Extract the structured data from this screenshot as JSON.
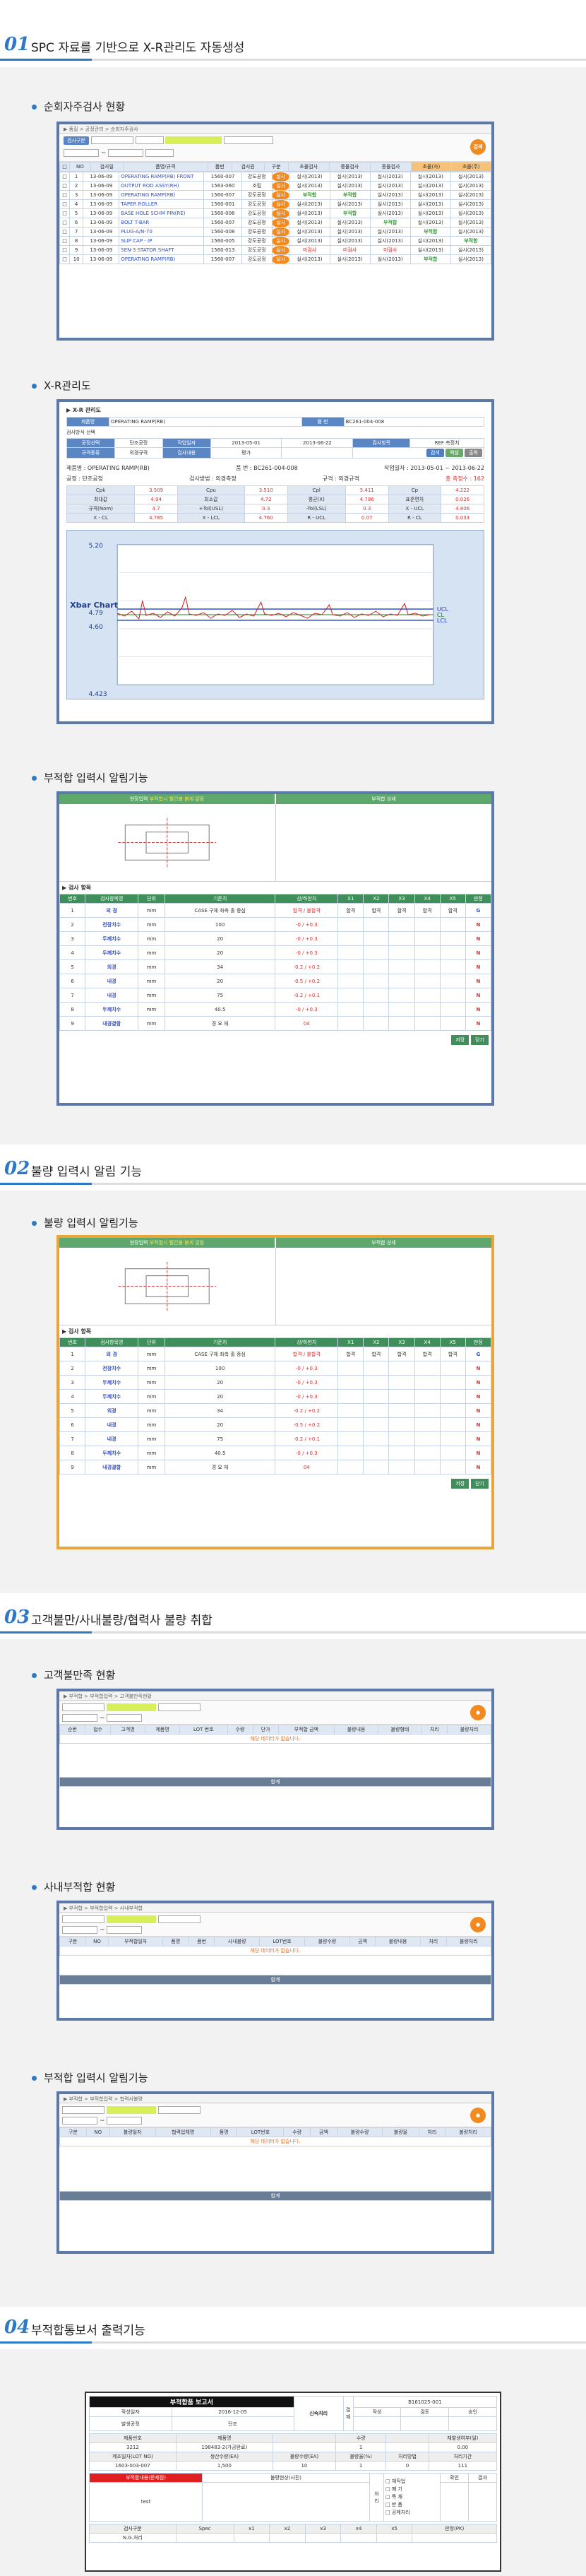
{
  "sections": [
    {
      "num": "01",
      "title": "SPC 자료를 기반으로 X-R관리도 자동생성"
    },
    {
      "num": "02",
      "title": "불량 입력시 알림 기능"
    },
    {
      "num": "03",
      "title": "고객불만/사내불량/협력사 불량 취합"
    },
    {
      "num": "04",
      "title": "부적합통보서 출력기능"
    }
  ],
  "subs": {
    "s1a": "순회자주검사 현황",
    "s1b": "X-R관리도",
    "s1c": "부적합 입력시 알림기능",
    "s2a": "불량 입력시 알림기능",
    "s3a": "고객불만족 현황",
    "s3b": "사내부적합 현황",
    "s3c": "부적합 입력시 알림기능",
    "s4": "부적합통보서 출력기능"
  },
  "inspection": {
    "breadcrumb": "▶ 품질 > 공정관리 > 순회자주검사",
    "search_btn": "검색",
    "filter_label": "검사구분",
    "headers": [
      "",
      "NO",
      "검사일",
      "품명/규격",
      "품번",
      "검사원",
      "구분",
      "초물검사",
      "중물검사",
      "종물검사",
      "초물(자)",
      "초물(주)",
      "비고"
    ],
    "rows": [
      [
        "1",
        "13-06-09",
        "OPERATING RAMP(RB) FRONT",
        "1560-007",
        "강도공정",
        "실시",
        "실시(2013)",
        "실시(2013)",
        "실시(2013)",
        "실시(2013)",
        "실시(2013)"
      ],
      [
        "2",
        "13-06-09",
        "OUTPUT ROD ASSY(RH)",
        "1563-060",
        "조립",
        "실시",
        "실시(2013)",
        "실시(2013)",
        "실시(2013)",
        "실시(2013)",
        "실시(2013)"
      ],
      [
        "3",
        "13-06-09",
        "OPERATING RAMP(RB)",
        "1560-007",
        "강도공정",
        "실시",
        "부적합",
        "부적합",
        "실시(2013)",
        "실시(2013)",
        "실시(2013)"
      ],
      [
        "4",
        "13-06-09",
        "TAPER ROLLER",
        "1560-001",
        "강도공정",
        "실시",
        "실시(2013)",
        "실시(2013)",
        "실시(2013)",
        "실시(2013)",
        "실시(2013)"
      ],
      [
        "5",
        "13-06-09",
        "BASE HOLE SCHM PIN(RE)",
        "1560-006",
        "강도공정",
        "실시",
        "실시(2013)",
        "부적합",
        "실시(2013)",
        "실시(2013)",
        "실시(2013)"
      ],
      [
        "6",
        "13-06-09",
        "BOLT T-BAR",
        "1560-007",
        "강도공정",
        "실시",
        "실시(2013)",
        "실시(2013)",
        "부적합",
        "실시(2013)",
        "실시(2013)"
      ],
      [
        "7",
        "13-06-09",
        "PLUG-A/N-70",
        "1560-008",
        "강도공정",
        "실시",
        "실시(2013)",
        "실시(2013)",
        "실시(2013)",
        "부적합",
        "실시(2013)"
      ],
      [
        "8",
        "13-06-09",
        "SLIP CAP - IP",
        "1560-005",
        "강도공정",
        "실시",
        "실시(2013)",
        "실시(2013)",
        "실시(2013)",
        "실시(2013)",
        "부적합"
      ],
      [
        "9",
        "13-06-09",
        "SEN-3 STATOR SHAFT",
        "1560-013",
        "강도공정",
        "실시",
        "미검사",
        "미검사",
        "미검사",
        "실시(2013)",
        "실시(2013)"
      ],
      [
        "10",
        "13-06-09",
        "OPERATING RAMP(RB)",
        "1560-007",
        "강도공정",
        "실시",
        "실시(2013)",
        "실시(2013)",
        "실시(2013)",
        "부적합",
        "실시(2013)"
      ]
    ]
  },
  "xr": {
    "title": "▶ X-R 관리도",
    "part_label": "제품명",
    "part_value": "OPERATING RAMP(RB)",
    "no_label": "품 번",
    "no_value": "BC261-004-008",
    "chk": "검사방식 선택",
    "r1": [
      "공정선택",
      "단조공정",
      "작업일자",
      "2013-05-01",
      "2013-06-22",
      "검사항목",
      "REF 측정치"
    ],
    "r2": [
      "규격종류",
      "외경규격",
      "검사내용",
      "평가"
    ],
    "btns": [
      "검색",
      "엑셀",
      "출력"
    ],
    "info": [
      "제품명 : OPERATING RAMP(RB)",
      "품 번 : BC261-004-008",
      "작업일자 : 2013-05-01 ~ 2013-06-22"
    ],
    "info2": [
      "공정 : 단조공정",
      "검사방법 : 외경측정",
      "규격 : 외경규격",
      "총 측정수 : 162"
    ],
    "stats": [
      [
        "Cpk",
        "3.509",
        "Cpu",
        "3.510",
        "Cpl",
        "5.411",
        "Cp",
        "4.222"
      ],
      [
        "최대값",
        "4.94",
        "최소값",
        "4.72",
        "평균(X)",
        "4.786",
        "표준편차",
        "0.026"
      ],
      [
        "규격(Nom)",
        "4.7",
        "+Tol(USL)",
        "0.3",
        "-Tol(LSL)",
        "0.3",
        "X - UCL",
        "4.806"
      ],
      [
        "X - CL",
        "4.785",
        "X - LCL",
        "4.760",
        "R - UCL",
        "0.07",
        "R - CL",
        "0.033"
      ]
    ],
    "chart_title": "Xbar Chart",
    "ymax": "5.20",
    "ymid": "4.79",
    "ymin": "4.60",
    "ybottom": "4.423",
    "legend": [
      "UCL",
      "CL",
      "LCL"
    ]
  },
  "ncr": {
    "tab_a": "현장입력",
    "tab_a_note": "부적합시 빨간불 붉게 알람",
    "tab_b": "부적합 상세",
    "sub_title": "▶ 검사 항목",
    "headers": [
      "번호",
      "검사항목명",
      "단위",
      "기준치",
      "상/하한치",
      "X1",
      "X2",
      "X3",
      "X4",
      "X5",
      "판정"
    ],
    "rows": [
      [
        "1",
        "외 경",
        "mm",
        "CASE 구체 좌측 홀 중심",
        "합격 / 불합격",
        "합격",
        "합격",
        "합격",
        "합격",
        "합격",
        "G"
      ],
      [
        "2",
        "전장치수",
        "mm",
        "100",
        "-0 / +0.3",
        "",
        "",
        "",
        "",
        "",
        "N"
      ],
      [
        "3",
        "두께치수",
        "mm",
        "20",
        "-0 / +0.3",
        "",
        "",
        "",
        "",
        "",
        "N"
      ],
      [
        "4",
        "두께치수",
        "mm",
        "20",
        "-0 / +0.3",
        "",
        "",
        "",
        "",
        "",
        "N"
      ],
      [
        "5",
        "외경",
        "mm",
        "34",
        "-0.2 / +0.2",
        "",
        "",
        "",
        "",
        "",
        "N"
      ],
      [
        "6",
        "내경",
        "mm",
        "20",
        "-0.5 / +0.2",
        "",
        "",
        "",
        "",
        "",
        "N"
      ],
      [
        "7",
        "내경",
        "mm",
        "75",
        "-0.2 / +0.1",
        "",
        "",
        "",
        "",
        "",
        "N"
      ],
      [
        "8",
        "두께치수",
        "mm",
        "40.5",
        "-0 / +0.3",
        "",
        "",
        "",
        "",
        "",
        "N"
      ],
      [
        "9",
        "내경결합",
        "mm",
        "경 요 체",
        "04",
        "",
        "",
        "",
        "",
        "",
        "N"
      ]
    ],
    "save": "저장",
    "close": "닫기"
  },
  "customer": {
    "breadcrumb": "▶ 부적합 > 부적합입력 > 고객불만족현황",
    "headers": [
      "순번",
      "접수",
      "고객명",
      "제품명",
      "LOT 번호",
      "수량",
      "단가",
      "부적합 금액",
      "불량내용",
      "불량형태",
      "처리",
      "불량처리"
    ],
    "empty": "해당 데이터가 없습니다.",
    "total": "합계"
  },
  "internal": {
    "breadcrumb": "▶ 부적합 > 부적합입력 > 사내부적합",
    "headers": [
      "구분",
      "NO",
      "부적합일자",
      "품명",
      "품번",
      "사내불량",
      "LOT번호",
      "불량수량",
      "금액",
      "불량내용",
      "처리",
      "불량처리"
    ],
    "empty": "해당 데이터가 없습니다.",
    "total": "합계"
  },
  "supplier": {
    "breadcrumb": "▶ 부적합 > 부적합입력 > 협력사불량",
    "headers": [
      "구분",
      "NO",
      "불량일자",
      "협력업체명",
      "품명",
      "LOT번호",
      "수량",
      "금액",
      "불량수량",
      "불량율",
      "처리",
      "불량처리"
    ],
    "empty": "해당 데이터가 없습니다.",
    "total": "합계"
  },
  "report": {
    "title": "부적합품 보고서",
    "doc_no": "B161025-001",
    "date_label": "작성일자",
    "date": "2016-12-05",
    "team_label": "발생공정",
    "team": "단조",
    "dept": "신속처리",
    "sign": [
      "작성",
      "검토",
      "승인"
    ],
    "cols1": [
      "제품번호",
      "제품명",
      "",
      "수량",
      "",
      "재발생여부(일)"
    ],
    "vals1": [
      "3212",
      "198483-2(가공완료)",
      "",
      "1",
      "",
      "0.00"
    ],
    "cols2": [
      "제조일자(LOT NO)",
      "생산수량(EA)",
      "불량수량(EA)",
      "불량율(%)",
      "처리방법",
      "처리기간"
    ],
    "vals2": [
      "1603-003-007",
      "1,500",
      "10",
      "1",
      "0",
      "111"
    ],
    "cause": "부적합내용(문제점)",
    "detail": "불량현상(사진)",
    "result_opts": [
      "재작업",
      "폐 기",
      "특 채",
      "반 품",
      "공제처리"
    ],
    "note": "test",
    "bottom": [
      "검사구분",
      "Spec",
      "x1",
      "x2",
      "x3",
      "x4",
      "x5",
      "판정(PK)"
    ],
    "lot": "N.G.처리"
  }
}
